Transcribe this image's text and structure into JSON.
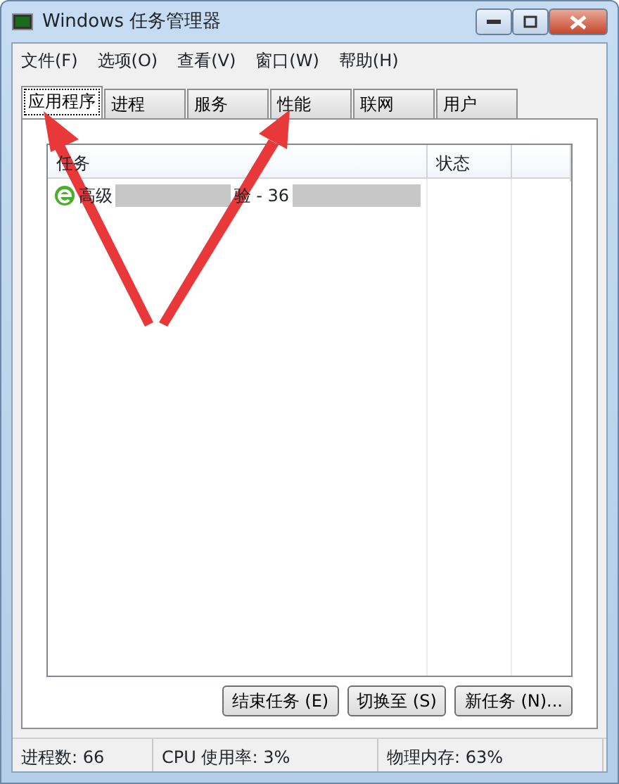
{
  "window": {
    "title": "Windows 任务管理器"
  },
  "menu": [
    "文件(F)",
    "选项(O)",
    "查看(V)",
    "窗口(W)",
    "帮助(H)"
  ],
  "tabs": [
    {
      "label": "应用程序",
      "selected": true
    },
    {
      "label": "进程",
      "selected": false
    },
    {
      "label": "服务",
      "selected": false
    },
    {
      "label": "性能",
      "selected": false
    },
    {
      "label": "联网",
      "selected": false
    },
    {
      "label": "用户",
      "selected": false
    }
  ],
  "table": {
    "columns": [
      "任务",
      "状态"
    ],
    "rows": [
      {
        "parts": [
          "高级",
          "验 - 36"
        ]
      }
    ]
  },
  "buttons": [
    "结束任务 (E)",
    "切换至 (S)",
    "新任务 (N)..."
  ],
  "status_bar": [
    "进程数: 66",
    "CPU 使用率: 3%",
    "物理内存: 63%"
  ]
}
